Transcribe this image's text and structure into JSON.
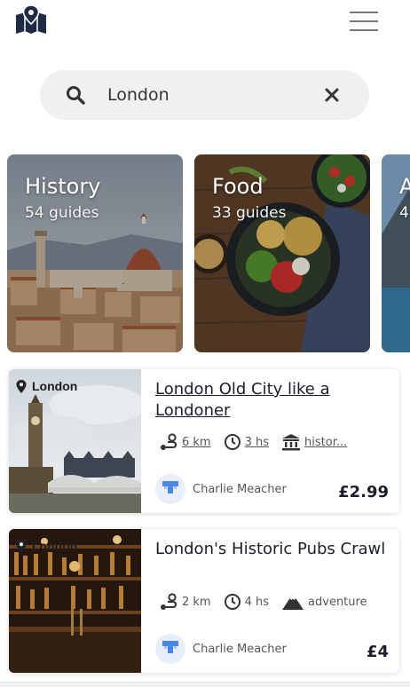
{
  "search": {
    "value": "London",
    "placeholder": "Search"
  },
  "categories": [
    {
      "title": "History",
      "subtitle": "54 guides"
    },
    {
      "title": "Food",
      "subtitle": "33 guides"
    },
    {
      "title": "A",
      "subtitle": "4"
    }
  ],
  "tours": [
    {
      "location": "London",
      "title": "London Old City like a Londoner",
      "distance": "6 km",
      "duration": "3 hs",
      "tag": "histor...",
      "tag_icon": "museum-icon",
      "author": "Charlie Meacher",
      "price": "£2.99"
    },
    {
      "location": "London",
      "title": "London's Historic Pubs Crawl",
      "distance": "2 km",
      "duration": "4 hs",
      "tag": "adventure",
      "tag_icon": "mountain-icon",
      "author": "Charlie Meacher",
      "price": "£4"
    }
  ],
  "colors": {
    "accent": "#1b1e2b",
    "search_bg": "#eff0f2",
    "avatar": "#4a86e8"
  }
}
